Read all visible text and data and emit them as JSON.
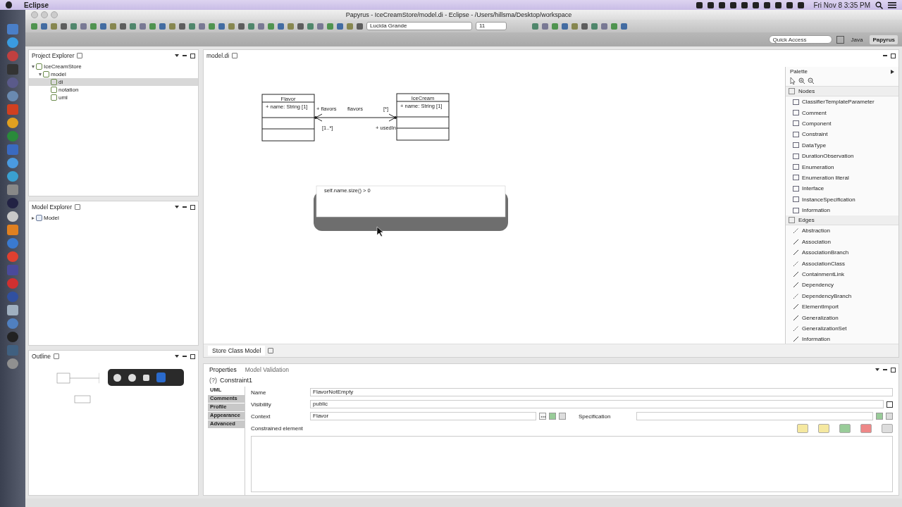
{
  "menubar": {
    "app": "Eclipse",
    "clock": "Fri Nov 8  3:35 PM"
  },
  "window": {
    "title": "Papyrus - IceCreamStore/model.di - Eclipse - /Users/hillsma/Desktop/workspace"
  },
  "toolbar": {
    "font": "Lucida Grande",
    "size": "11",
    "quick_access": {
      "placeholder": "Quick Access"
    },
    "perspectives": [
      {
        "label": "Java",
        "selected": false
      },
      {
        "label": "Papyrus",
        "selected": true
      }
    ]
  },
  "project_explorer": {
    "title": "Project Explorer",
    "tree": [
      {
        "label": "IceCreamStore",
        "expanded": true,
        "selected": false,
        "children": [
          {
            "label": "model",
            "expanded": true,
            "selected": false,
            "children": [
              {
                "label": "di",
                "selected": true
              },
              {
                "label": "notation",
                "selected": false
              },
              {
                "label": "uml",
                "selected": false
              }
            ]
          }
        ]
      }
    ]
  },
  "model_explorer": {
    "title": "Model Explorer",
    "tree": [
      {
        "label": "Model",
        "expanded": false,
        "selected": false
      }
    ]
  },
  "outline": {
    "title": "Outline"
  },
  "editor": {
    "tab": "model.di",
    "diagram_tab": "Store Class Model",
    "classes": [
      {
        "name": "Flavor",
        "attributes": [
          "+ name: String [1]"
        ]
      },
      {
        "name": "IceCream",
        "attributes": [
          "+ name: String [1]"
        ]
      }
    ],
    "association_labels": [
      "+ flavors",
      "flavors",
      "[*]",
      "[1..*]",
      "+ usedIn"
    ],
    "constraint": {
      "body": "self.name.size() > 0"
    }
  },
  "palette": {
    "title": "Palette",
    "sections": [
      {
        "title": "Nodes",
        "items": [
          "ClassifierTemplateParameter",
          "Comment",
          "Component",
          "Constraint",
          "DataType",
          "DurationObservation",
          "Enumeration",
          "Enumeration literal",
          "Interface",
          "InstanceSpecification",
          "Information"
        ]
      },
      {
        "title": "Edges",
        "items": [
          "Abstraction",
          "Association",
          "AssociationBranch",
          "AssociationClass",
          "ContainmentLink",
          "Dependency",
          "DependencyBranch",
          "ElementImport",
          "Generalization",
          "GeneralizationSet",
          "Information"
        ]
      }
    ]
  },
  "properties": {
    "tabs": [
      {
        "label": "Properties",
        "selected": true
      },
      {
        "label": "Model Validation",
        "selected": false
      }
    ],
    "element": {
      "icon_text": "(?)",
      "name": "Constraint1"
    },
    "side_tabs": [
      {
        "label": "UML",
        "selected": true
      },
      {
        "label": "Comments",
        "selected": false
      },
      {
        "label": "Profile",
        "selected": false
      },
      {
        "label": "Appearance",
        "selected": false
      },
      {
        "label": "Advanced",
        "selected": false
      }
    ],
    "name": {
      "label": "Name",
      "value": "FlavorNotEmpty"
    },
    "visibility": {
      "label": "Visibility",
      "value": "public"
    },
    "context": {
      "label": "Context",
      "value": "Flavor"
    },
    "specification": {
      "label": "Specification"
    },
    "constrained": {
      "label": "Constrained element"
    }
  }
}
